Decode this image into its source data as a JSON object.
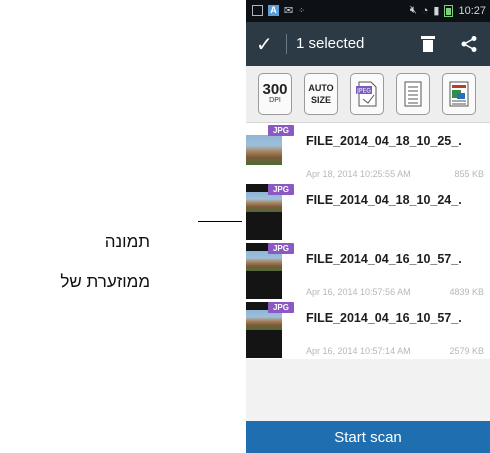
{
  "annotation": {
    "line1": "תמונה",
    "line2": "ממוזערת של"
  },
  "statusbar": {
    "time": "10:27"
  },
  "actionbar": {
    "selected_label": "1 selected"
  },
  "toolbar": {
    "dpi_value": "300",
    "dpi_unit": "DPI",
    "auto_line1": "AUTO",
    "auto_line2": "SIZE",
    "jpeg_label": "JPEG"
  },
  "files": [
    {
      "name": "FILE_2014_04_18_10_25_.",
      "date": "Apr 18, 2014 10:25:55 AM",
      "size": "855 KB",
      "badge": "JPG"
    },
    {
      "name": "FILE_2014_04_18_10_24_.",
      "date": "",
      "size": "",
      "badge": "JPG"
    },
    {
      "name": "FILE_2014_04_16_10_57_.",
      "date": "Apr 16, 2014 10:57:56 AM",
      "size": "4839 KB",
      "badge": "JPG"
    },
    {
      "name": "FILE_2014_04_16_10_57_.",
      "date": "Apr 16, 2014 10:57:14 AM",
      "size": "2579 KB",
      "badge": "JPG"
    }
  ],
  "scan_button": "Start scan",
  "colors": {
    "actionbar": "#2b3a45",
    "scanbar": "#1f6fb0",
    "badge": "#8a59c3"
  }
}
